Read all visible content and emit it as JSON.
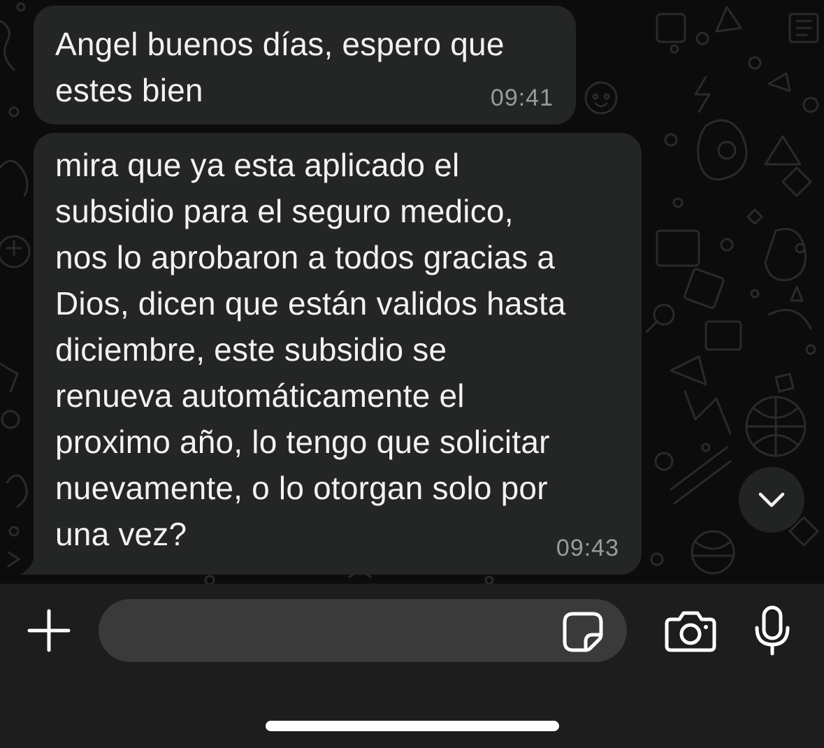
{
  "messages": [
    {
      "text": "Angel buenos días, espero que\nestes bien",
      "time": "09:41"
    },
    {
      "text": "mira que ya esta aplicado el\nsubsidio para el seguro medico,\nnos lo aprobaron a todos gracias a\nDios, dicen que están validos hasta\ndiciembre, este subsidio se\nrenueva automáticamente el\nproximo año, lo tengo que solicitar\nnuevamente, o lo otorgan solo por\nuna vez?",
      "time": "09:43"
    }
  ],
  "composer": {
    "input_value": "",
    "plus_icon": "plus-icon",
    "sticker_icon": "sticker-icon",
    "camera_icon": "camera-icon",
    "mic_icon": "microphone-icon"
  },
  "scroll_button": {
    "icon": "chevron-down-icon"
  },
  "colors": {
    "chat_background": "#0c0c0c",
    "bubble": "#242626",
    "bottom_bar": "#1d1d1d",
    "input": "#3a3a3a",
    "timestamp": "#9a9c9c",
    "text": "#f2f2f2"
  }
}
